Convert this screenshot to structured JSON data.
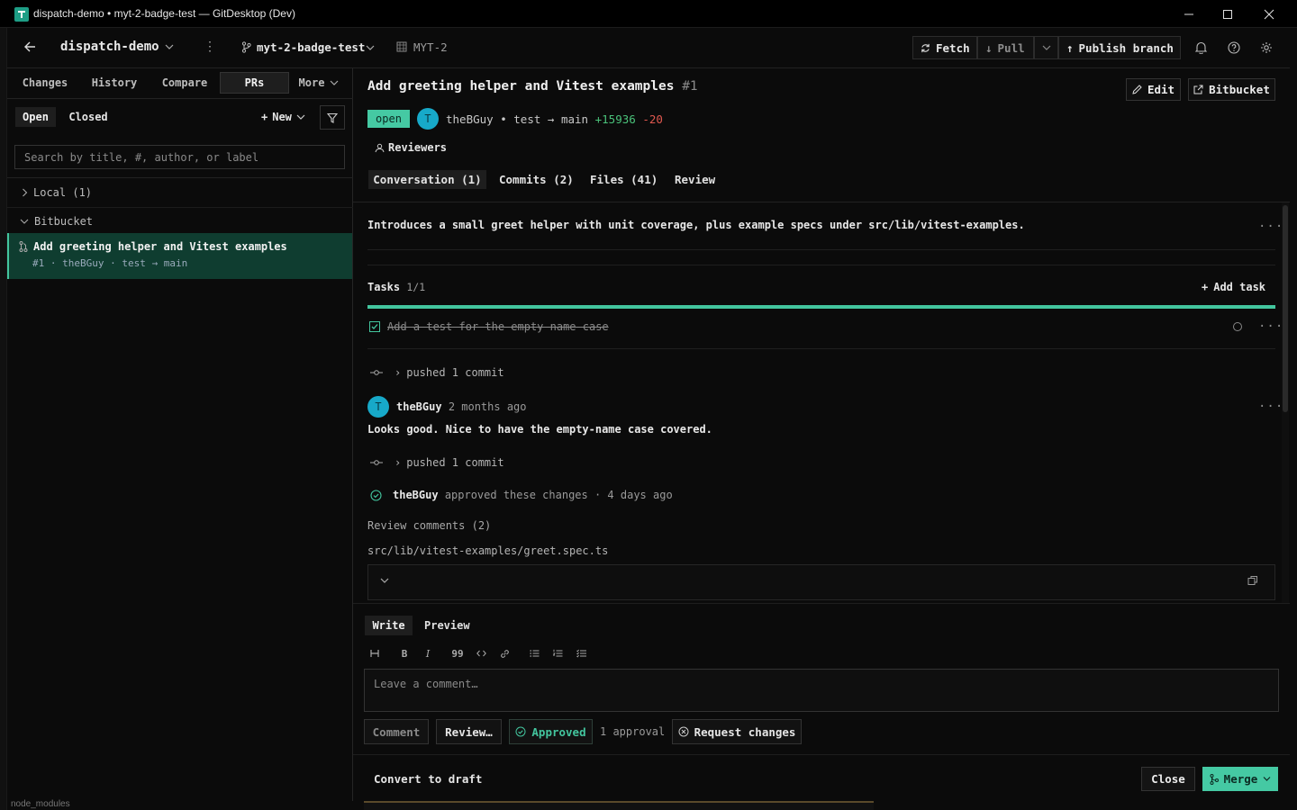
{
  "window": {
    "title": "dispatch-demo • myt-2-badge-test — GitDesktop (Dev)"
  },
  "toolbar": {
    "repo": "dispatch-demo",
    "branch": "myt-2-badge-test",
    "issue": "MYT-2",
    "fetch": "Fetch",
    "pull": "Pull",
    "publish": "Publish branch"
  },
  "sidebar": {
    "tabs": [
      "Changes",
      "History",
      "Compare",
      "PRs",
      "More"
    ],
    "active_tab": "PRs",
    "filter_open": "Open",
    "filter_closed": "Closed",
    "new_label": "New",
    "search_placeholder": "Search by title, #, author, or label",
    "groups": [
      {
        "label": "Local (1)"
      },
      {
        "label": "Bitbucket"
      }
    ],
    "selected_pr": {
      "title": "Add greeting helper and Vitest examples",
      "meta": "#1 · theBGuy · test → main"
    }
  },
  "pr": {
    "title": "Add greeting helper and Vitest examples",
    "number": "#1",
    "status": "open",
    "avatar_initial": "T",
    "author": "theBGuy",
    "source_branch": "test",
    "target_branch": "main",
    "additions": "+15936",
    "deletions": "-20",
    "edit": "Edit",
    "bitbucket": "Bitbucket",
    "reviewers": "Reviewers",
    "tabs": [
      "Conversation (1)",
      "Commits (2)",
      "Files (41)",
      "Review"
    ],
    "description": "Introduces a small greet helper with unit coverage, plus example specs under src/lib/vitest-examples.",
    "tasks_label": "Tasks",
    "tasks_count": "1/1",
    "tasks_progress": 1.0,
    "add_task": "Add task",
    "task_item": "Add a test for the empty-name case",
    "timeline": {
      "push1": "pushed 1 commit",
      "comment_author": "theBGuy",
      "comment_time": "2 months ago",
      "comment_body": "Looks good. Nice to have the empty-name case covered.",
      "push2": "pushed 1 commit",
      "approval_author": "theBGuy",
      "approval_text": "approved these changes · 4 days ago",
      "review_comments": "Review comments (2)",
      "file_path": "src/lib/vitest-examples/greet.spec.ts"
    }
  },
  "composer": {
    "write": "Write",
    "preview": "Preview",
    "placeholder": "Leave a comment…",
    "comment": "Comment",
    "review": "Review…",
    "approved": "Approved",
    "approval_count": "1 approval",
    "request_changes": "Request changes",
    "convert_draft": "Convert to draft",
    "close": "Close",
    "merge": "Merge"
  },
  "statusbar": {
    "left_text": "node_modules"
  },
  "colors": {
    "accent": "#43c59e",
    "accent_bg": "#45c9a3",
    "selected_row": "#0f3d30",
    "additions": "#4ac27a",
    "deletions": "#e0584f"
  }
}
